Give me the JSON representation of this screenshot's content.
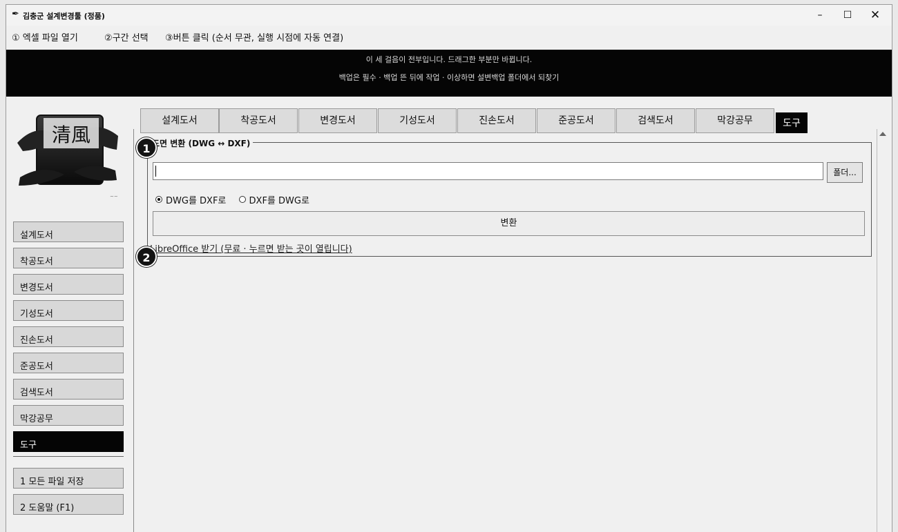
{
  "window": {
    "title": "김충군 설계변경툴 (정품)",
    "controls": {
      "minimize": "–",
      "maximize": "☐",
      "close": "✕"
    }
  },
  "menu": {
    "items": [
      "① 엑셀 파일 열기",
      "②구간 선택",
      "③버튼 클릭 (순서 무관, 실행 시점에 자동 연결)"
    ]
  },
  "banner": {
    "line1": "이 세 걸음이 전부입니다. 드래그한 부분만 바뀝니다.",
    "line2": "백업은 필수 · 백업 뜬 뒤에 작업 · 이상하면 설변백업 폴더에서 되찾기"
  },
  "sidebar": {
    "logo_chars": "清風",
    "items": [
      "설계도서",
      "착공도서",
      "변경도서",
      "기성도서",
      "진손도서",
      "준공도서",
      "검색도서",
      "막강공무",
      "도구"
    ],
    "active": "도구",
    "extra": [
      "1 모든 파일 저장",
      "2 도움말 (F1)"
    ]
  },
  "tabs": {
    "items": [
      "설계도서",
      "착공도서",
      "변경도서",
      "기성도서",
      "진손도서",
      "준공도서",
      "검색도서",
      "막강공무"
    ],
    "active_label": "도구"
  },
  "converter": {
    "group_title": "도면 변환 (DWG ↔ DXF)",
    "path_value": "",
    "folder_button": "폴더...",
    "radio_options": [
      "DWG를 DXF로",
      "DXF를 DWG로"
    ],
    "selected_option": "DWG를 DXF로",
    "convert_button": "변환",
    "libreoffice_link": "LibreOffice 받기 (무료 · 누르면 받는 곳이 열립니다)"
  },
  "badges": [
    "1",
    "2"
  ]
}
